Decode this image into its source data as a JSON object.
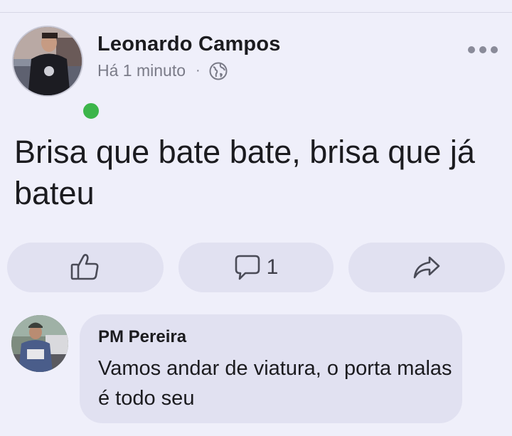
{
  "post": {
    "author": "Leonardo Campos",
    "timestamp": "Há 1 minuto",
    "separator": "·",
    "privacy_icon": "globe-icon",
    "online": true,
    "more_icon": "more-horizontal-icon",
    "text": "Brisa que bate bate, brisa que já bateu"
  },
  "actions": {
    "like_icon": "thumbs-up-icon",
    "comment_icon": "comment-bubble-icon",
    "comment_count": "1",
    "share_icon": "share-arrow-icon"
  },
  "comment": {
    "author": "PM Pereira",
    "text": "Vamos andar de viatura, o porta malas é todo seu"
  },
  "colors": {
    "background": "#efeffa",
    "button_bg": "#e1e1f1",
    "online_green": "#3cb54a",
    "text": "#1b1b1f",
    "muted": "#7a7b88"
  }
}
